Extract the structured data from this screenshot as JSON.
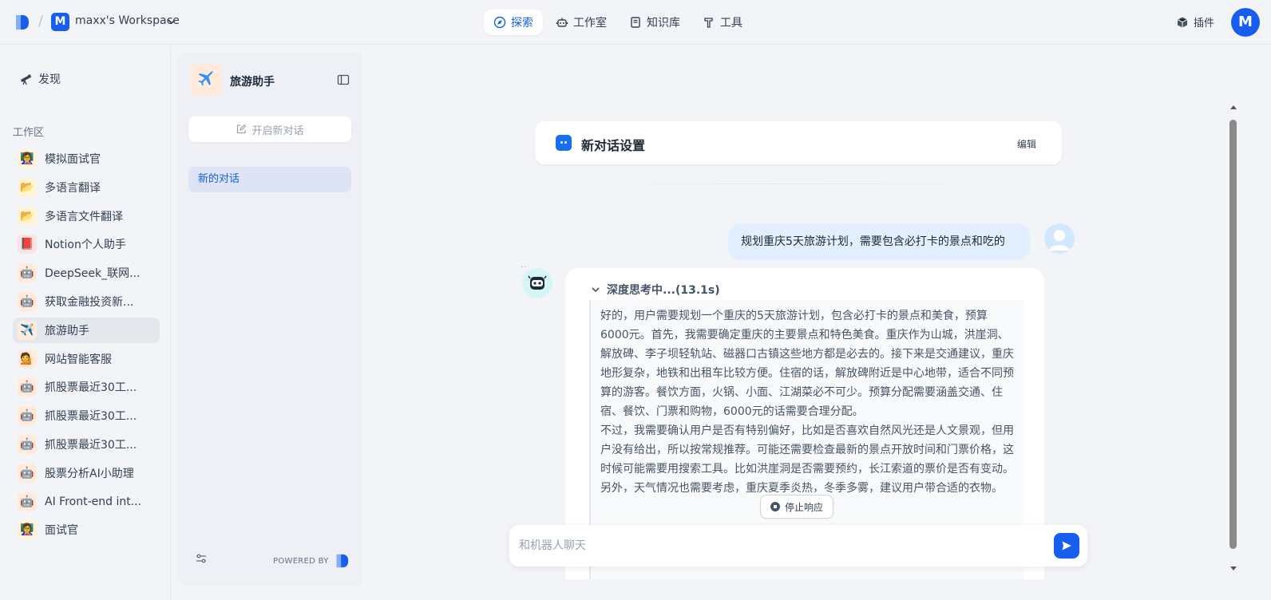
{
  "workspace": {
    "initial": "M",
    "name": "maxx's Workspace"
  },
  "nav": {
    "explore": "探索",
    "studio": "工作室",
    "knowledge": "知识库",
    "tools": "工具"
  },
  "header": {
    "plugins": "插件",
    "user_initial": "M"
  },
  "sidebar": {
    "discover": "发现",
    "section": "工作区",
    "apps": [
      {
        "label": "模拟面试官"
      },
      {
        "label": "多语言翻译"
      },
      {
        "label": "多语言文件翻译"
      },
      {
        "label": "Notion个人助手"
      },
      {
        "label": "DeepSeek_联网..."
      },
      {
        "label": "获取金融投资新..."
      },
      {
        "label": "旅游助手"
      },
      {
        "label": "网站智能客服"
      },
      {
        "label": "抓股票最近30工..."
      },
      {
        "label": "抓股票最近30工..."
      },
      {
        "label": "抓股票最近30工..."
      },
      {
        "label": "股票分析AI小助理"
      },
      {
        "label": "AI Front-end int..."
      },
      {
        "label": "面试官"
      }
    ]
  },
  "panel": {
    "bot_name": "旅游助手",
    "new_chat": "开启新对话",
    "conversation": "新的对话",
    "powered_by": "POWERED BY"
  },
  "chat": {
    "settings_title": "新对话设置",
    "edit": "编辑",
    "user_message": "规划重庆5天旅游计划，需要包含必打卡的景点和吃的",
    "thinking_label": "深度思考中...(13.1s)",
    "thinking_p1": "好的，用户需要规划一个重庆的5天旅游计划，包含必打卡的景点和美食，预算6000元。首先，我需要确定重庆的主要景点和特色美食。重庆作为山城，洪崖洞、解放碑、李子坝轻轨站、磁器口古镇这些地方都是必去的。接下来是交通建议，重庆地形复杂，地铁和出租车比较方便。住宿的话，解放碑附近是中心地带，适合不同预算的游客。餐饮方面，火锅、小面、江湖菜必不可少。预算分配需要涵盖交通、住宿、餐饮、门票和购物，6000元的话需要合理分配。",
    "thinking_p2": "不过，我需要确认用户是否有特别偏好，比如是否喜欢自然风光还是人文景观，但用户没有给出，所以按常规推荐。可能还需要检查最新的景点开放时间和门票价格，这时候可能需要用搜索工具。比如洪崖洞是否需要预约，长江索道的票价是否有变动。另外，天气情况也需要考虑，重庆夏季炎热，冬季多雾，建议用户带合适的衣物。",
    "stop": "停止响应",
    "input_placeholder": "和机器人聊天"
  },
  "colors": {
    "accent": "#155eef",
    "user_bubble": "#e1effe"
  }
}
